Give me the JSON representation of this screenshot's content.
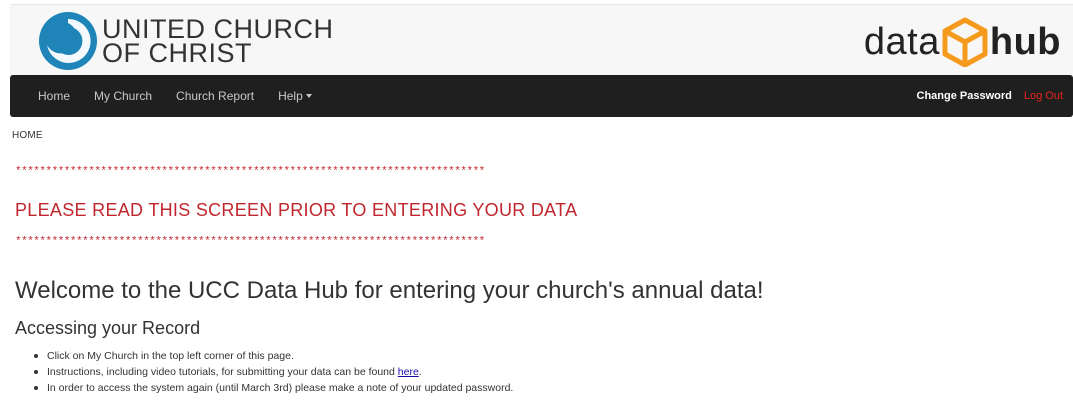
{
  "brand": {
    "ucc_line1": "UNITED CHURCH",
    "ucc_line2": "OF CHRIST",
    "hub_word1": "data",
    "hub_word2": "hub",
    "colors": {
      "ucc_blue": "#1f84b8",
      "hub_orange": "#f59a1c",
      "nav_bg": "#1f1f1f",
      "notice_red": "#c0262d",
      "logout_red": "#e8221b"
    }
  },
  "nav": {
    "items": [
      {
        "label": "Home"
      },
      {
        "label": "My Church"
      },
      {
        "label": "Church Report"
      },
      {
        "label": "Help"
      }
    ],
    "help_icon": "caret-down-icon",
    "change_password": "Change Password",
    "logout": "Log Out"
  },
  "breadcrumb": "HOME",
  "notice": {
    "stars": "*****************************************************************************",
    "text": "PLEASE READ THIS SCREEN PRIOR TO ENTERING YOUR DATA"
  },
  "content": {
    "welcome": "Welcome to the UCC Data Hub for entering your church's annual data!",
    "section_title": "Accessing your Record",
    "items": [
      {
        "text": "Click on My Church in the top left corner of this page."
      },
      {
        "text_before": "Instructions, including video tutorials, for submitting your data can be found ",
        "link": "here",
        "text_after": "."
      },
      {
        "text": "In order to access the system again (until March 3rd) please make a note of your updated password."
      }
    ]
  }
}
